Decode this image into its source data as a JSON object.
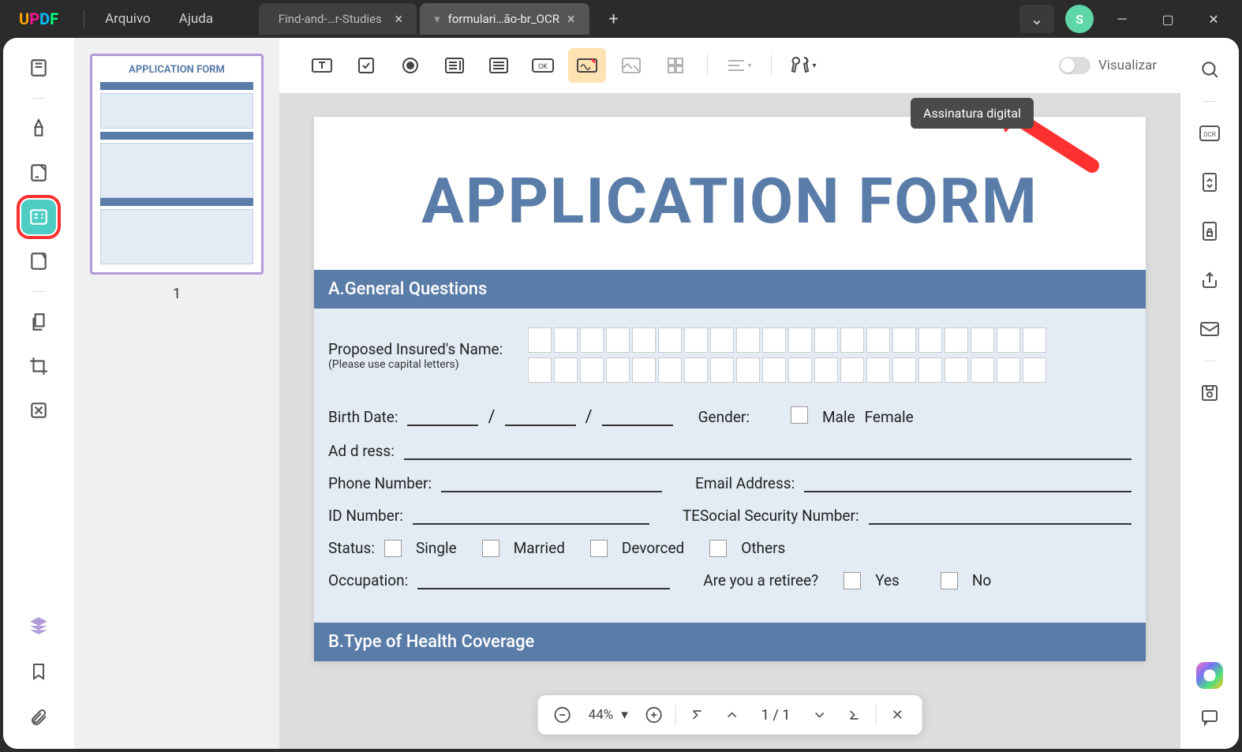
{
  "app": {
    "logo": "UPDF"
  },
  "menu": {
    "file": "Arquivo",
    "help": "Ajuda"
  },
  "tabs": {
    "t1": "Find-and-…r-Studies",
    "t2": "formulari…ão-br_OCR"
  },
  "avatar": "S",
  "tooltip": "Assinatura digital",
  "preview": "Visualizar",
  "thumb": {
    "title": "APPLICATION FORM",
    "num": "1"
  },
  "doc": {
    "title": "APPLICATION FORM",
    "secA": "A.General Questions",
    "secB": "B.Type of Health Coverage",
    "name": "Proposed Insured's Name:",
    "nameSub": "(Please use capital letters)",
    "birth": "Birth Date:",
    "gender": "Gender:",
    "male": "Male",
    "female": "Female",
    "address": "Ad d ress:",
    "phone": "Phone Number:",
    "email": "Email Address:",
    "id": "ID Number:",
    "ssn": "TESocial Security Number:",
    "status": "Status:",
    "single": "Single",
    "married": "Married",
    "divorced": "Devorced",
    "others": "Others",
    "occupation": "Occupation:",
    "retiree": "Are you a retiree?",
    "yes": "Yes",
    "no": "No"
  },
  "pager": {
    "zoom": "44%",
    "page": "1 / 1"
  },
  "icons": {
    "tick1": "/",
    "tick2": "/"
  }
}
